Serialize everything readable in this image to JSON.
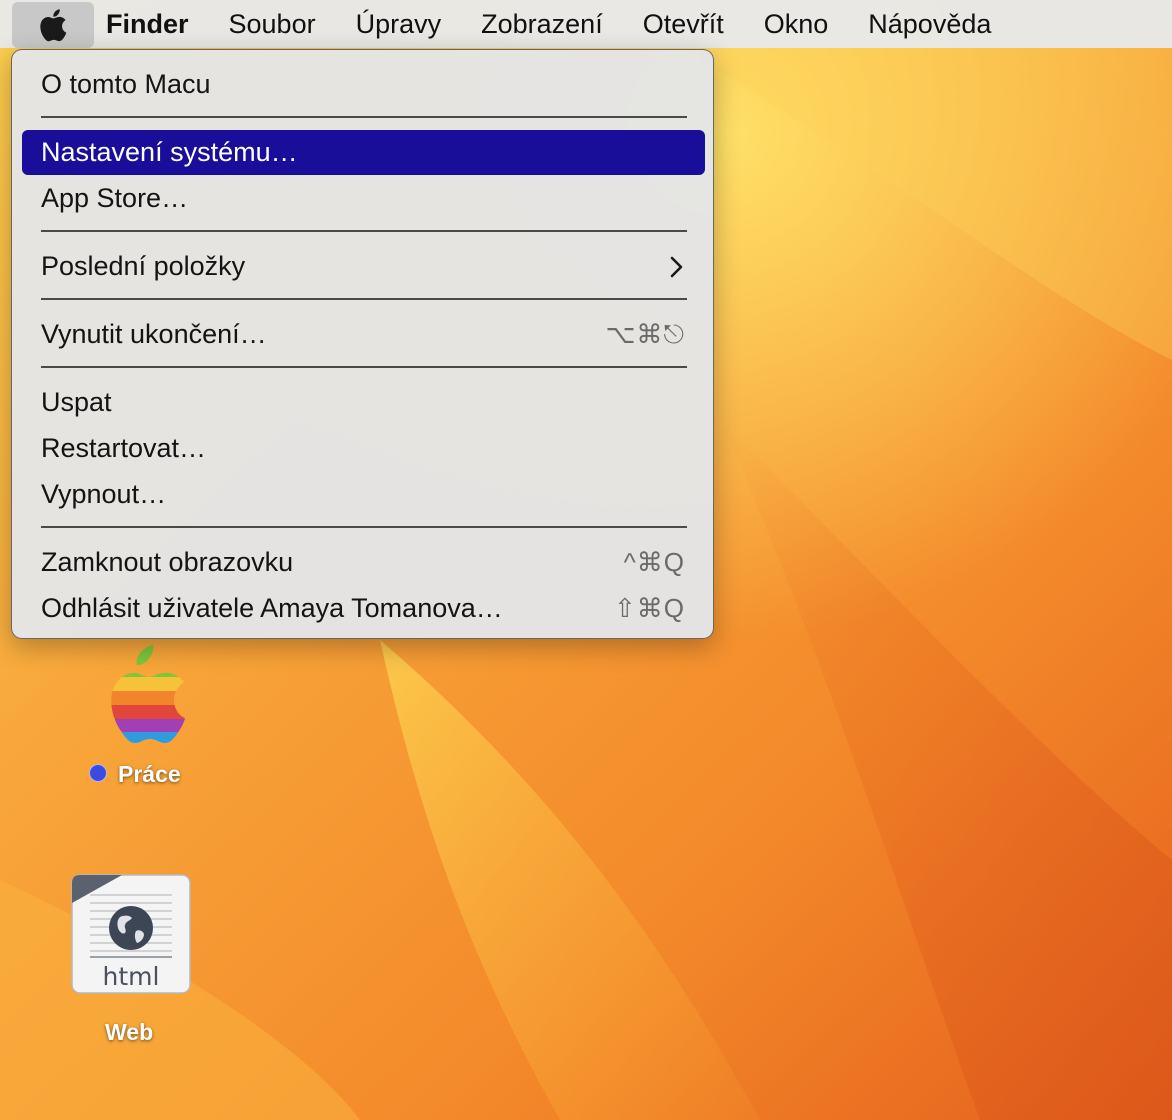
{
  "menubar": {
    "apple_icon": "apple-logo-icon",
    "app_name": "Finder",
    "items": [
      "Soubor",
      "Úpravy",
      "Zobrazení",
      "Otevřít",
      "Okno",
      "Nápověda"
    ]
  },
  "apple_menu": {
    "items": [
      {
        "label": "O tomto Macu"
      },
      {
        "label": "Nastavení systému…",
        "highlighted": true
      },
      {
        "label": "App Store…"
      },
      {
        "label": "Poslední položky",
        "submenu_icon": "chevron-right-icon"
      },
      {
        "label": "Vynutit ukončení…",
        "shortcut": "⌥⌘⎋"
      },
      {
        "label": "Uspat"
      },
      {
        "label": "Restartovat…"
      },
      {
        "label": "Vypnout…"
      },
      {
        "label": "Zamknout obrazovku",
        "shortcut": "^⌘Q"
      },
      {
        "label": "Odhlásit uživatele Amaya Tomanova…",
        "shortcut": "⇧⌘Q"
      }
    ]
  },
  "desktop": {
    "icons": [
      {
        "label": "Práce",
        "tag_color": "#3b4be0",
        "icon": "rainbow-apple-folder-icon"
      },
      {
        "label": "Web",
        "icon": "html-document-icon",
        "icon_text": "html"
      }
    ]
  },
  "colors": {
    "menu_highlight": "#180e9a",
    "wallpaper_primary": "#f39a2e",
    "wallpaper_light": "#fbd24a"
  }
}
